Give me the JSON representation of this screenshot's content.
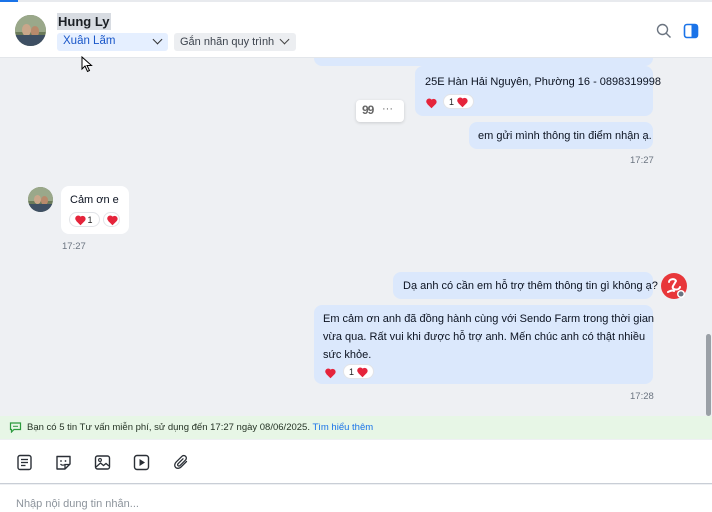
{
  "header": {
    "contact_name": "Hung Ly",
    "assignee": "Xuân Lãm",
    "tag_placeholder": "Gắn nhãn quy trình",
    "search_icon": "search-icon",
    "panel_icon": "side-panel-icon"
  },
  "messages": [
    {
      "id": "m0",
      "direction": "out",
      "text": ""
    },
    {
      "id": "m1",
      "direction": "out",
      "text": "25E Hàn Hải Nguyên, Phường 16 - 0898319998",
      "reactions": {
        "count": "1"
      }
    },
    {
      "id": "m2",
      "direction": "out",
      "text": "em gửi mình thông tin điểm nhận ạ.",
      "time": "17:27"
    },
    {
      "id": "m3",
      "direction": "in",
      "text": "Cảm ơn e",
      "reactions": {
        "count": "1"
      },
      "time": "17:27"
    },
    {
      "id": "m4",
      "direction": "out",
      "text": "Dạ anh có cần em hỗ trợ thêm thông tin gì không ạ?"
    },
    {
      "id": "m5",
      "direction": "out",
      "lines": [
        "Em cảm ơn anh đã đồng hành cùng với Sendo Farm trong thời gian",
        "vừa qua. Rất vui khi được hỗ trợ anh. Mến chúc anh có thật nhiều",
        "sức khỏe."
      ],
      "reactions": {
        "count": "1"
      },
      "time": "17:28"
    }
  ],
  "quote_tool": {
    "quote_glyph": "99",
    "more_glyph": "···"
  },
  "notice": {
    "text": "Bạn có 5 tin Tư vấn miễn phí, sử dụng đến 17:27 ngày 08/06/2025.",
    "link": "Tìm hiểu thêm"
  },
  "toolbar": {
    "items": [
      "note-icon",
      "sticker-icon",
      "image-icon",
      "video-icon",
      "attachment-icon"
    ]
  },
  "composer": {
    "placeholder": "Nhập nội dung tin nhắn..."
  },
  "colors": {
    "accent": "#1a73e8",
    "outgoing_bubble": "#dbe8fc",
    "incoming_bubble": "#ffffff",
    "heart": "#e5243b",
    "notice_bg": "#e7f6e6",
    "agent_avatar": "#e8373a"
  }
}
